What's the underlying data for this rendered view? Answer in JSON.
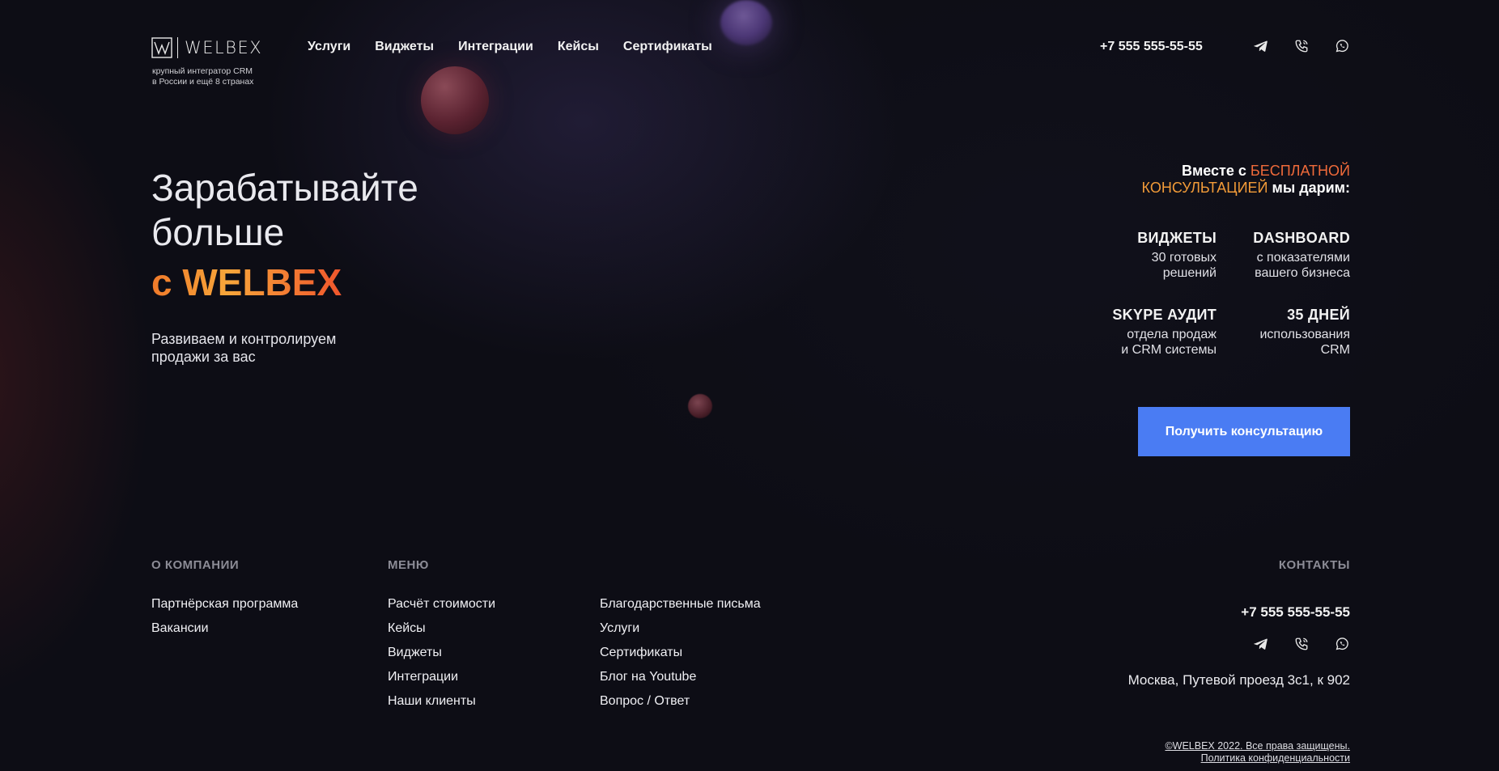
{
  "header": {
    "logo_text": "WELBEX",
    "tagline_line1": "крупный интегратор CRM",
    "tagline_line2": "в России и ещё 8 странах",
    "nav": [
      "Услуги",
      "Виджеты",
      "Интеграции",
      "Кейсы",
      "Сертификаты"
    ],
    "phone": "+7 555 555-55-55",
    "icons": [
      "telegram-icon",
      "phone-icon",
      "whatsapp-icon"
    ]
  },
  "hero": {
    "title_line1": "Зарабатывайте",
    "title_line2": "больше",
    "brand_line": "с WELBEX",
    "subtitle_line1": "Развиваем и контролируем",
    "subtitle_line2": "продажи за вас"
  },
  "offer": {
    "heading_part1": "Вместе с ",
    "heading_highlight1": "БЕСПЛАТНОЙ",
    "heading_highlight2": "КОНСУЛЬТАЦИЕЙ",
    "heading_part2": " мы дарим:",
    "features": [
      {
        "title": "ВИДЖЕТЫ",
        "line1": "30 готовых",
        "line2": "решений"
      },
      {
        "title": "DASHBOARD",
        "line1": "с показателями",
        "line2": "вашего бизнеса"
      },
      {
        "title": "SKYPE АУДИТ",
        "line1": "отдела продаж",
        "line2": "и CRM системы"
      },
      {
        "title": "35 ДНЕЙ",
        "line1": "использования",
        "line2": "CRM"
      }
    ],
    "cta_label": "Получить консультацию"
  },
  "footer": {
    "company_heading": "О КОМПАНИИ",
    "company_links": [
      "Партнёрская программа",
      "Вакансии"
    ],
    "menu_heading": "МЕНЮ",
    "menu_col1": [
      "Расчёт стоимости",
      "Кейсы",
      "Виджеты",
      "Интеграции",
      "Наши клиенты"
    ],
    "menu_col2": [
      "Благодарственные письма",
      "Услуги",
      "Сертификаты",
      "Блог на Youtube",
      "Вопрос / Ответ"
    ],
    "contacts_heading": "КОНТАКТЫ",
    "phone": "+7 555 555-55-55",
    "address": "Москва, Путевой проезд 3с1, к 902",
    "copyright": "©WELBEX 2022. Все права защищены.",
    "privacy": "Политика конфиденциальности"
  },
  "colors": {
    "background": "#0d0d15",
    "accent_blue": "#4a7cf3",
    "brand_orange": "#f29b38",
    "brand_red": "#ef6a3a"
  }
}
